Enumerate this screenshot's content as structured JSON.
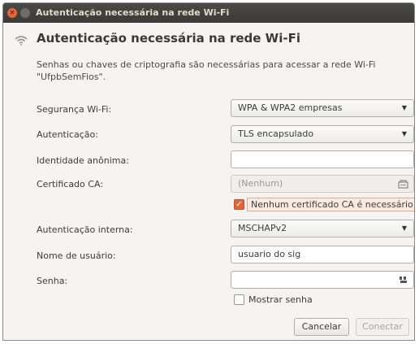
{
  "window": {
    "title": "Autenticação necessária na rede Wi-Fi"
  },
  "header": {
    "title": "Autenticação necessária na rede Wi-Fi",
    "description": "Senhas ou chaves de criptografia são necessárias para acessar a rede Wi-Fi \"UfpbSemFios\"."
  },
  "form": {
    "security": {
      "label": "Segurança Wi-Fi:",
      "value": "WPA & WPA2 empresas"
    },
    "authentication": {
      "label": "Autenticação:",
      "value": "TLS encapsulado"
    },
    "anonymous_identity": {
      "label": "Identidade anônima:",
      "value": ""
    },
    "ca_certificate": {
      "label": "Certificado CA:",
      "value": "(Nenhum)"
    },
    "no_ca_required": {
      "label": "Nenhum certificado CA é necessário",
      "checked": true
    },
    "inner_auth": {
      "label": "Autenticação interna:",
      "value": "MSCHAPv2"
    },
    "username": {
      "label": "Nome de usuário:",
      "value": "usuario do sig"
    },
    "password": {
      "label": "Senha:",
      "value": ""
    },
    "show_password": {
      "label": "Mostrar senha",
      "checked": false
    }
  },
  "buttons": {
    "cancel": "Cancelar",
    "connect": "Conectar"
  },
  "colors": {
    "accent": "#e0663c",
    "titlebar": "#3b3a36"
  }
}
